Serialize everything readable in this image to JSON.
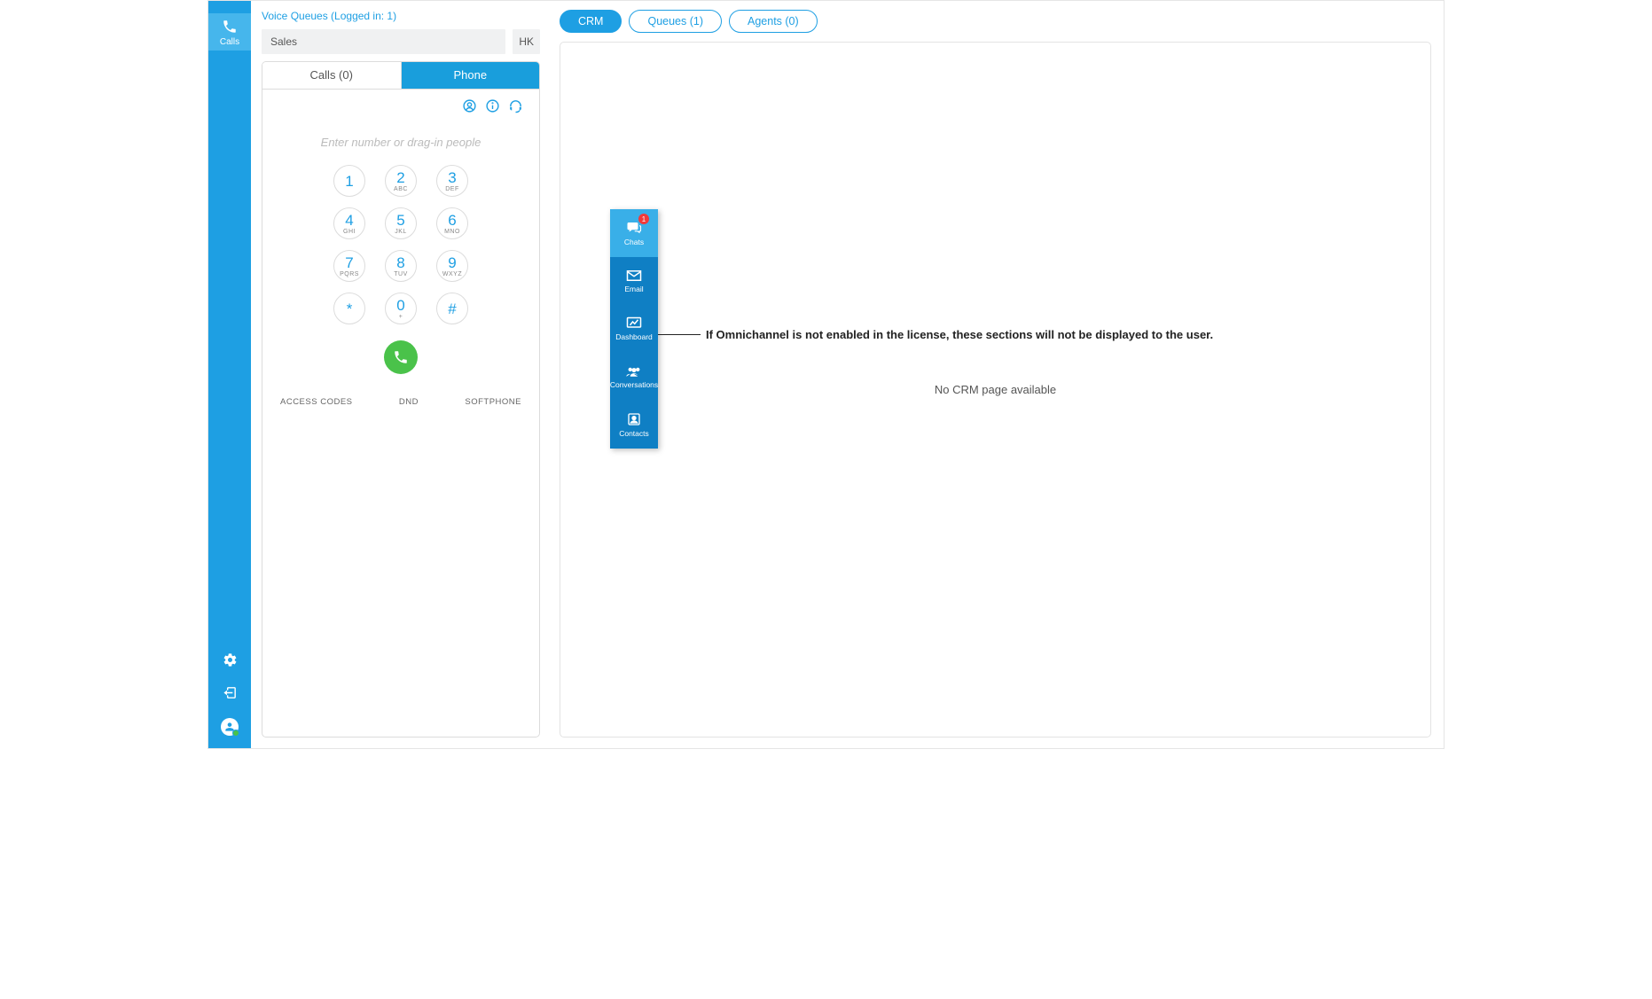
{
  "rail": {
    "top": {
      "label": "Calls"
    }
  },
  "panel": {
    "voice_queues_title": "Voice Queues (Logged in: 1)",
    "queue_name": "Sales",
    "hk": "HK",
    "tabs": {
      "calls": "Calls (0)",
      "phone": "Phone"
    },
    "number_placeholder": "Enter number or drag-in people",
    "keypad": [
      [
        {
          "n": "1",
          "l": ""
        },
        {
          "n": "2",
          "l": "ABC"
        },
        {
          "n": "3",
          "l": "DEF"
        }
      ],
      [
        {
          "n": "4",
          "l": "GHI"
        },
        {
          "n": "5",
          "l": "JKL"
        },
        {
          "n": "6",
          "l": "MNO"
        }
      ],
      [
        {
          "n": "7",
          "l": "PQRS"
        },
        {
          "n": "8",
          "l": "TUV"
        },
        {
          "n": "9",
          "l": "WXYZ"
        }
      ],
      [
        {
          "n": "*",
          "l": ""
        },
        {
          "n": "0",
          "l": "+"
        },
        {
          "n": "#",
          "l": ""
        }
      ]
    ],
    "bottom": {
      "access": "ACCESS CODES",
      "dnd": "DND",
      "soft": "SOFTPHONE"
    }
  },
  "top_tabs": {
    "crm": "CRM",
    "queues": "Queues (1)",
    "agents": "Agents (0)"
  },
  "content": {
    "no_crm": "No CRM page available"
  },
  "omni": {
    "items": [
      {
        "label": "Chats",
        "badge": "1"
      },
      {
        "label": "Email"
      },
      {
        "label": "Dashboard"
      },
      {
        "label": "Conversations"
      },
      {
        "label": "Contacts"
      }
    ]
  },
  "annotation": "If Omnichannel is not enabled in the license, these sections will not be displayed to the user."
}
